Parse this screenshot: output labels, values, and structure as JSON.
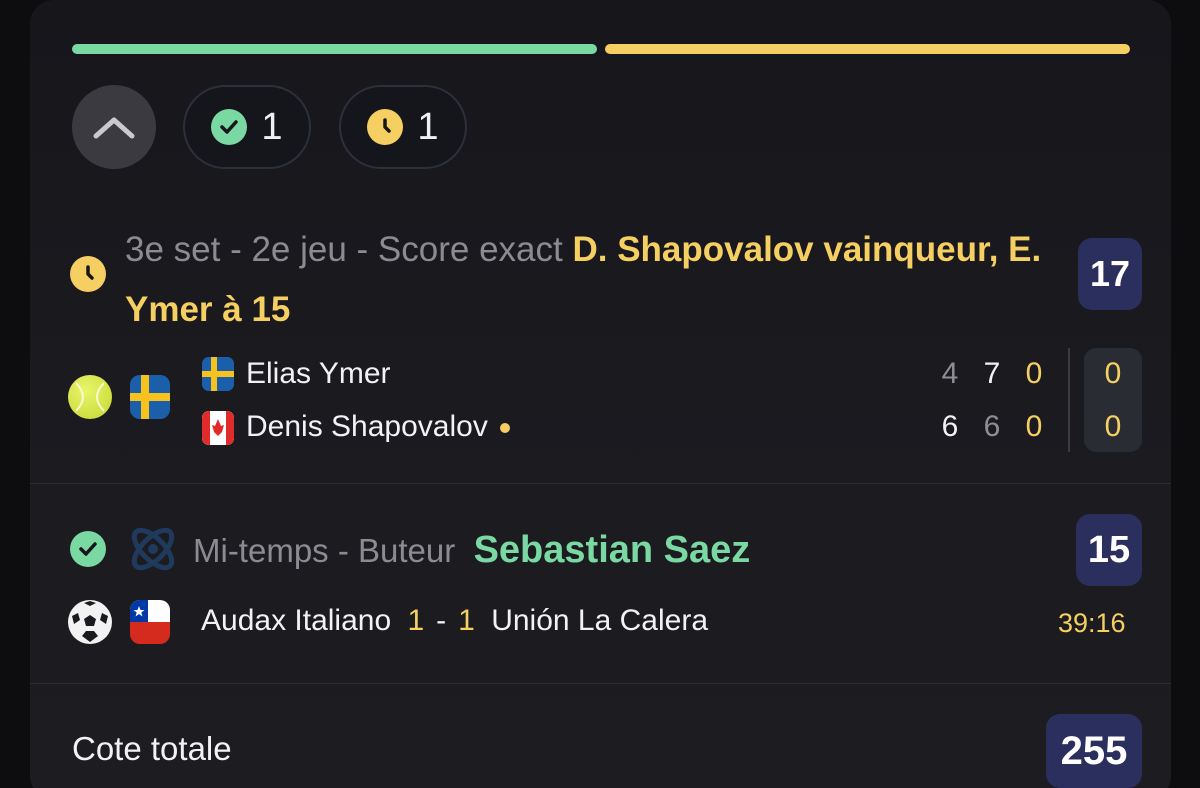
{
  "summary": {
    "won_count": "1",
    "pending_count": "1"
  },
  "colors": {
    "won": "#7ad9a3",
    "pending": "#f5cf62",
    "odds_bg": "#2b2f5e"
  },
  "progress": {
    "won_fraction": 0.5,
    "pending_fraction": 0.5
  },
  "bets": [
    {
      "status": "pending",
      "market": "3e set - 2e jeu - Score exact",
      "selection": "D. Shapovalov vainqueur, E. Ymer à 15",
      "odds": "17",
      "sport": "tennis",
      "players": [
        {
          "name": "Elias Ymer",
          "flag": "sweden",
          "sets": [
            "4",
            "7",
            "0"
          ],
          "game": "0",
          "serving": false
        },
        {
          "name": "Denis Shapovalov",
          "flag": "canada",
          "sets": [
            "6",
            "6",
            "0"
          ],
          "game": "0",
          "serving": true
        }
      ]
    },
    {
      "status": "won",
      "market": "Mi-temps - Buteur",
      "selection": "Sebastian Saez",
      "odds": "15",
      "sport": "football",
      "match": {
        "home": "Audax Italiano",
        "home_score": "1",
        "away_score": "1",
        "away": "Unión La Calera",
        "time": "39:16",
        "country_flag": "chile"
      }
    }
  ],
  "total": {
    "label": "Cote totale",
    "odds": "255"
  }
}
